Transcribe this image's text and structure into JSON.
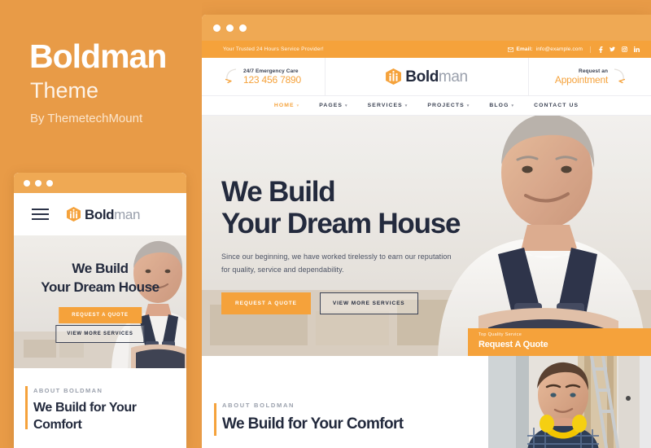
{
  "promo": {
    "title": "Boldman",
    "subtitle": "Theme",
    "byline": "By ThemetechMount",
    "bg_color": "#E89B47"
  },
  "theme": {
    "accent": "#F5A23B",
    "chrome": "#EFA954",
    "dark": "#232a3d",
    "muted": "#9aa0ac"
  },
  "logo": {
    "bold": "Bold",
    "light": "man"
  },
  "browser": {
    "chrome_dots": 3,
    "topbar": {
      "tagline": "Your Trusted 24 Hours Service Provider!",
      "email_label": "Email:",
      "email_value": "info@example.com",
      "mail_icon": "envelope-icon",
      "socials": [
        {
          "name": "facebook-icon",
          "glyph": "f"
        },
        {
          "name": "twitter-icon",
          "glyph": "t"
        },
        {
          "name": "instagram-icon",
          "glyph": "ig"
        },
        {
          "name": "linkedin-icon",
          "glyph": "in"
        }
      ]
    },
    "header": {
      "left": {
        "icon": "phone-arrow-icon",
        "small": "24/7 Emergency Care",
        "big": "123 456 7890"
      },
      "right": {
        "icon": "arrow-loop-icon",
        "small": "Request an",
        "big": "Appointment"
      }
    },
    "nav": [
      {
        "label": "HOME",
        "caret": true,
        "active": true
      },
      {
        "label": "PAGES",
        "caret": true,
        "active": false
      },
      {
        "label": "SERVICES",
        "caret": true,
        "active": false
      },
      {
        "label": "PROJECTS",
        "caret": true,
        "active": false
      },
      {
        "label": "BLOG",
        "caret": true,
        "active": false
      },
      {
        "label": "CONTACT US",
        "caret": false,
        "active": false
      }
    ],
    "hero": {
      "heading_line1": "We Build",
      "heading_line2": "Your Dream House",
      "paragraph_line1": "Since our beginning, we have worked tirelessly to earn our reputation",
      "paragraph_line2": "for quality, service and dependability.",
      "btn_primary": "REQUEST A QUOTE",
      "btn_secondary": "VIEW MORE SERVICES",
      "badge_small": "Top Quality Service",
      "badge_big": "Request A Quote",
      "image_alt": "Smiling handyman in navy overalls with arms crossed"
    },
    "about": {
      "eyebrow": "ABOUT BOLDMAN",
      "title": "We Build for Your Comfort",
      "image_alt": "Young worker with yellow ear defenders near a ladder"
    }
  },
  "tablet": {
    "chrome_dots": 3,
    "menu_icon": "hamburger-menu-icon",
    "hero": {
      "heading_line1": "We Build",
      "heading_line2": "Your Dream House",
      "btn_primary": "REQUEST A QUOTE",
      "btn_secondary": "VIEW MORE SERVICES",
      "image_alt": "Smiling handyman in navy overalls"
    },
    "about": {
      "eyebrow": "ABOUT BOLDMAN",
      "title_line1": "We Build for Your",
      "title_line2": "Comfort"
    }
  }
}
